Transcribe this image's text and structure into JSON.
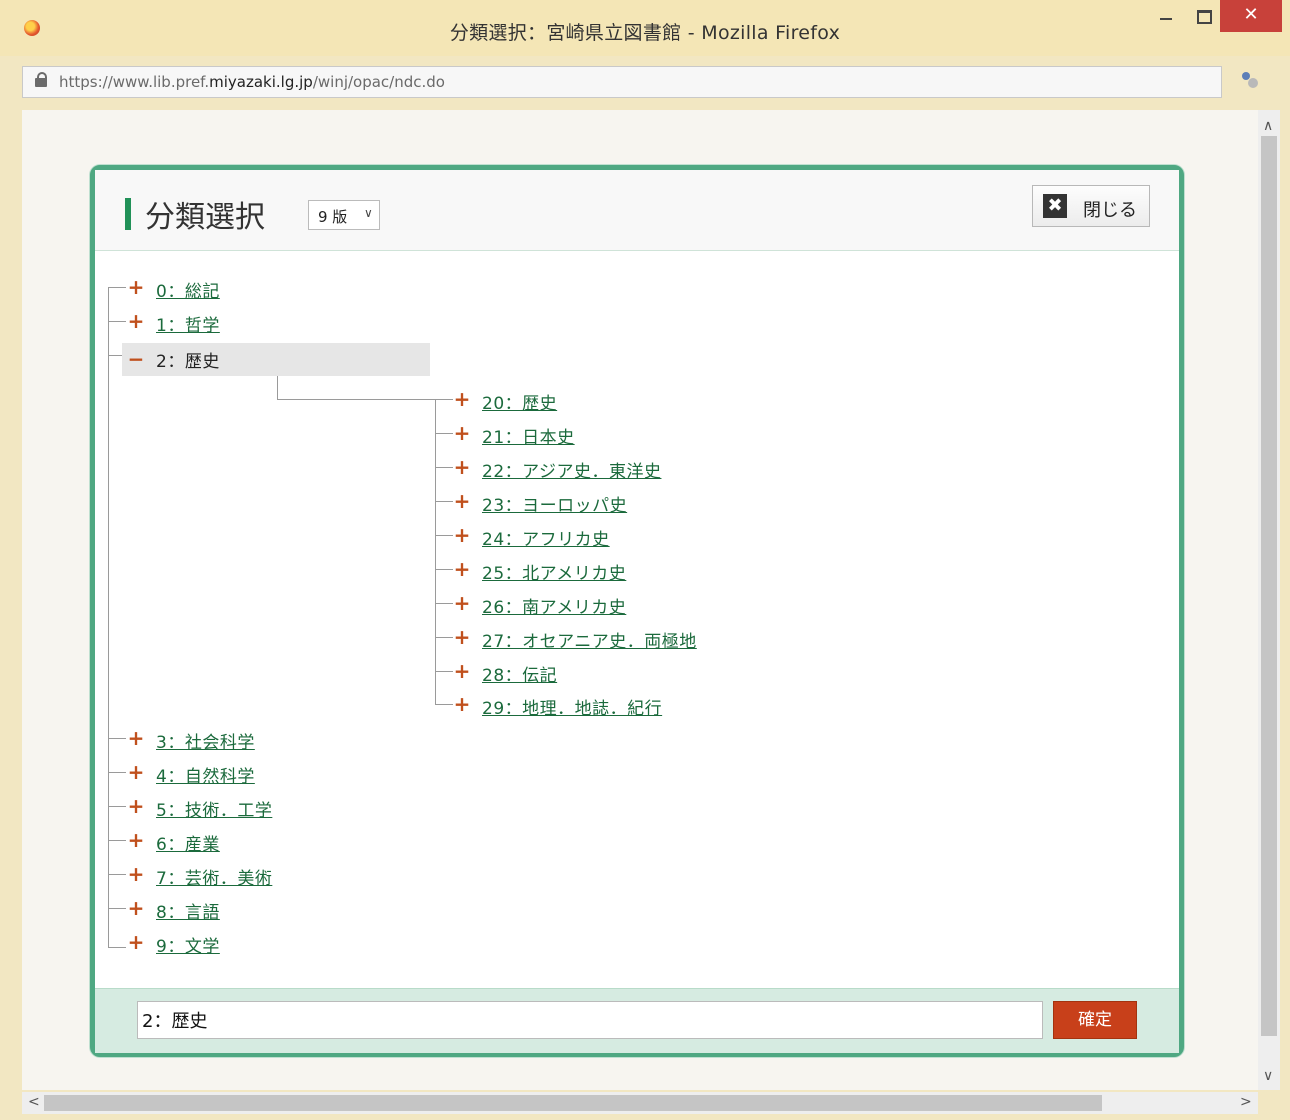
{
  "window": {
    "title": "分類選択：宮崎県立図書館 - Mozilla Firefox",
    "close_glyph": "✕"
  },
  "address": {
    "url_prefix": "https://www.lib.pref.",
    "url_domain": "miyazaki.lg.jp",
    "url_path": "/winj/opac/ndc.do"
  },
  "dialog": {
    "heading": "分類選択",
    "edition_select": {
      "value": "9 版"
    },
    "close_button": {
      "glyph": "✖",
      "label": "閉じる"
    },
    "tree": {
      "top_before": [
        {
          "label": "0：総記",
          "expander": "+"
        },
        {
          "label": "1：哲学",
          "expander": "+"
        }
      ],
      "selected": {
        "label": "2：歴史",
        "expander": "−"
      },
      "children": [
        {
          "label": "20：歴史",
          "expander": "+"
        },
        {
          "label": "21：日本史",
          "expander": "+"
        },
        {
          "label": "22：アジア史．東洋史",
          "expander": "+"
        },
        {
          "label": "23：ヨーロッパ史",
          "expander": "+"
        },
        {
          "label": "24：アフリカ史",
          "expander": "+"
        },
        {
          "label": "25：北アメリカ史",
          "expander": "+"
        },
        {
          "label": "26：南アメリカ史",
          "expander": "+"
        },
        {
          "label": "27：オセアニア史．両極地",
          "expander": "+"
        },
        {
          "label": "28：伝記",
          "expander": "+"
        },
        {
          "label": "29：地理．地誌．紀行",
          "expander": "+"
        }
      ],
      "top_after": [
        {
          "label": "3：社会科学",
          "expander": "+"
        },
        {
          "label": "4：自然科学",
          "expander": "+"
        },
        {
          "label": "5：技術．工学",
          "expander": "+"
        },
        {
          "label": "6：産業",
          "expander": "+"
        },
        {
          "label": "7：芸術．美術",
          "expander": "+"
        },
        {
          "label": "8：言語",
          "expander": "+"
        },
        {
          "label": "9：文学",
          "expander": "+"
        }
      ]
    },
    "footer": {
      "selection_value": "2：歴史",
      "confirm_label": "確定"
    }
  },
  "colors": {
    "accent_green": "#219158",
    "link_green": "#1b6a3c",
    "expander_orange": "#c0501d",
    "confirm_red": "#c8401a"
  }
}
